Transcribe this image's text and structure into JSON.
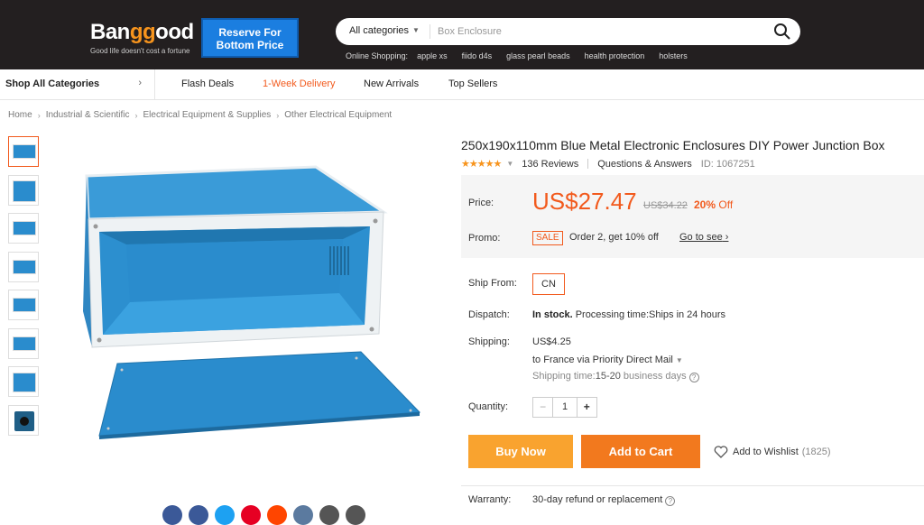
{
  "header": {
    "logo_main": "Ban",
    "logo_gg": "gg",
    "logo_end": "ood",
    "tagline": "Good life doesn't cost a fortune",
    "promo_banner": "Reserve For Bottom Price",
    "search": {
      "category": "All categories",
      "placeholder": "Box Enclosure"
    },
    "hotwords_label": "Online Shopping:",
    "hotwords": [
      "apple xs",
      "fiido d4s",
      "glass pearl beads",
      "health protection",
      "holsters"
    ]
  },
  "nav": {
    "shop_all": "Shop All Categories",
    "links": [
      "Flash Deals",
      "1-Week Delivery",
      "New Arrivals",
      "Top Sellers"
    ]
  },
  "breadcrumb": [
    "Home",
    "Industrial & Scientific",
    "Electrical Equipment & Supplies",
    "Other Electrical Equipment"
  ],
  "product": {
    "title": "250x190x110mm Blue Metal Electronic Enclosures DIY Power Junction Box",
    "stars": "★★★★★",
    "reviews": "136 Reviews",
    "qa": "Questions & Answers",
    "id": "ID: 1067251",
    "price_label": "Price:",
    "price": "US$27.47",
    "old_price": "US$34.22",
    "off_pct": "20%",
    "off_word": "Off",
    "promo_label": "Promo:",
    "sale_badge": "SALE",
    "promo_text": "Order 2, get 10% off",
    "go_to_see": "Go to see",
    "ship_from_label": "Ship From:",
    "ship_from": "CN",
    "dispatch_label": "Dispatch:",
    "dispatch_stock": "In stock.",
    "dispatch_text": "Processing time:Ships in 24 hours",
    "shipping_label": "Shipping:",
    "shipping_cost": "US$4.25",
    "shipping_via": "to France via Priority Direct Mail",
    "shipping_time_label": "Shipping time:",
    "shipping_time": "15-20",
    "shipping_time_unit": "business days",
    "quantity_label": "Quantity:",
    "quantity": "1",
    "buy_now": "Buy Now",
    "add_to_cart": "Add to Cart",
    "wishlist": "Add to Wishlist",
    "wishlist_count": "(1825)",
    "warranty_label": "Warranty:",
    "warranty": "30-day refund or replacement"
  },
  "colors": {
    "accent": "#f25a1d",
    "header_bg": "#231f20",
    "product_blue": "#2a8ccd"
  },
  "share_colors": [
    "#3b5998",
    "#3b5998",
    "#1da1f2",
    "#e60023",
    "#ff4500",
    "#5b7a9f",
    "#555555",
    "#555555"
  ]
}
